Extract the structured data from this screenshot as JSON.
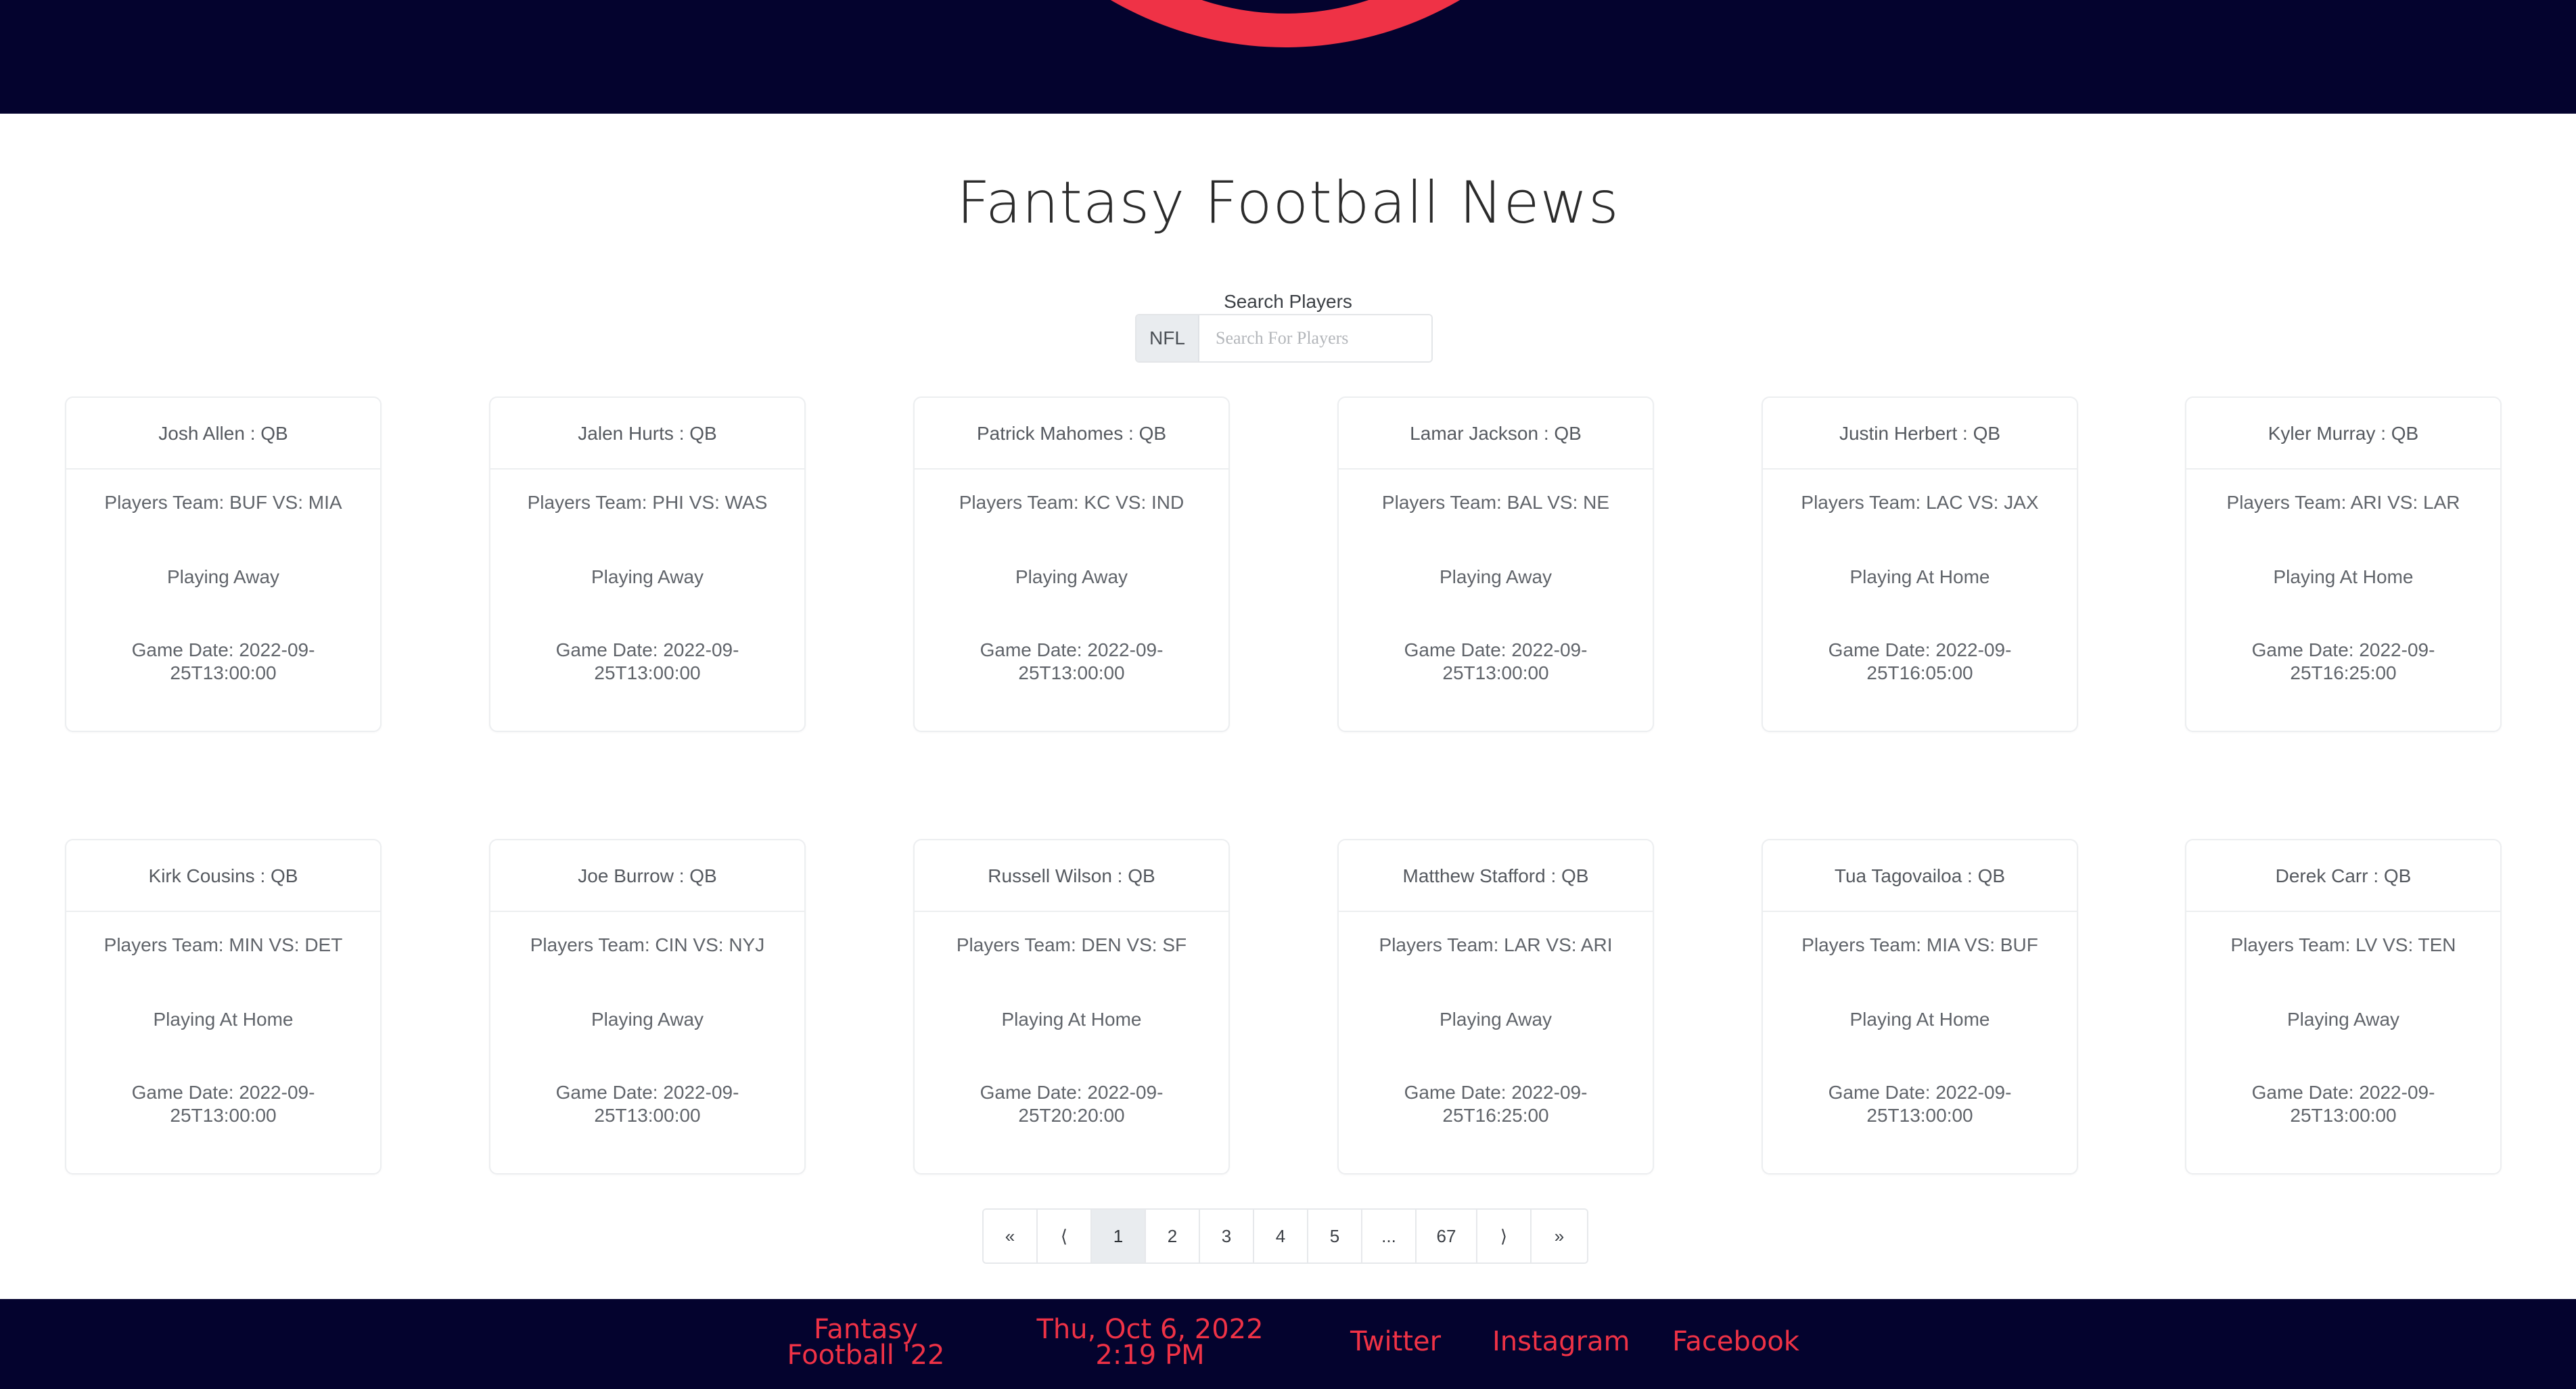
{
  "page": {
    "title": "Fantasy Football News",
    "search_label": "Search Players",
    "search_prefix": "NFL",
    "search_placeholder": "Search For Players",
    "search_value": ""
  },
  "colors": {
    "header_bg": "#04032e",
    "accent": "#ef3246",
    "card_border": "#eceef0",
    "active_page_bg": "#e9ecef"
  },
  "cards": [
    {
      "name": "Josh Allen : QB",
      "team": "Players Team: BUF VS: MIA",
      "home": "Playing Away",
      "date": "Game Date: 2022-09-25T13:00:00"
    },
    {
      "name": "Jalen Hurts : QB",
      "team": "Players Team: PHI VS: WAS",
      "home": "Playing Away",
      "date": "Game Date: 2022-09-25T13:00:00"
    },
    {
      "name": "Patrick Mahomes : QB",
      "team": "Players Team: KC VS: IND",
      "home": "Playing Away",
      "date": "Game Date: 2022-09-25T13:00:00"
    },
    {
      "name": "Lamar Jackson : QB",
      "team": "Players Team: BAL VS: NE",
      "home": "Playing Away",
      "date": "Game Date: 2022-09-25T13:00:00"
    },
    {
      "name": "Justin Herbert : QB",
      "team": "Players Team: LAC VS: JAX",
      "home": "Playing At Home",
      "date": "Game Date: 2022-09-25T16:05:00"
    },
    {
      "name": "Kyler Murray : QB",
      "team": "Players Team: ARI VS: LAR",
      "home": "Playing At Home",
      "date": "Game Date: 2022-09-25T16:25:00"
    },
    {
      "name": "Kirk Cousins : QB",
      "team": "Players Team: MIN VS: DET",
      "home": "Playing At Home",
      "date": "Game Date: 2022-09-25T13:00:00"
    },
    {
      "name": "Joe Burrow : QB",
      "team": "Players Team: CIN VS: NYJ",
      "home": "Playing Away",
      "date": "Game Date: 2022-09-25T13:00:00"
    },
    {
      "name": "Russell Wilson : QB",
      "team": "Players Team: DEN VS: SF",
      "home": "Playing At Home",
      "date": "Game Date: 2022-09-25T20:20:00"
    },
    {
      "name": "Matthew Stafford : QB",
      "team": "Players Team: LAR VS: ARI",
      "home": "Playing Away",
      "date": "Game Date: 2022-09-25T16:25:00"
    },
    {
      "name": "Tua Tagovailoa : QB",
      "team": "Players Team: MIA VS: BUF",
      "home": "Playing At Home",
      "date": "Game Date: 2022-09-25T13:00:00"
    },
    {
      "name": "Derek Carr : QB",
      "team": "Players Team: LV VS: TEN",
      "home": "Playing Away",
      "date": "Game Date: 2022-09-25T13:00:00"
    }
  ],
  "pagination": {
    "first": "«",
    "prev": "⟨",
    "pages": [
      "1",
      "2",
      "3",
      "4",
      "5",
      "...",
      "67"
    ],
    "next": "⟩",
    "last": "»",
    "current": "1"
  },
  "footer": {
    "brand": "Fantasy Football '22",
    "datetime": "Thu, Oct 6, 2022 2:19 PM",
    "twitter": "Twitter",
    "instagram": "Instagram",
    "facebook": "Facebook"
  }
}
